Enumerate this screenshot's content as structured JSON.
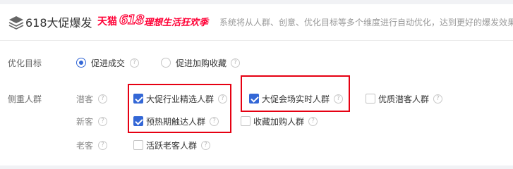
{
  "header": {
    "title": "618大促爆发",
    "logo_text_a": "天猫",
    "logo_text_num": "618",
    "logo_text_b": "理想生活狂欢季",
    "subtitle": "系统将从人群、创意、优化目标等多个维度进行自动优化，达到更好的爆发效果"
  },
  "optimization": {
    "label": "优化目标",
    "help": "?",
    "options": [
      {
        "label": "促进成交",
        "selected": true
      },
      {
        "label": "促进加购收藏",
        "selected": false
      }
    ]
  },
  "audience": {
    "label": "侧重人群",
    "help": "?",
    "groups": [
      {
        "label": "潜客",
        "options": [
          {
            "label": "大促行业精选人群",
            "checked": true
          },
          {
            "label": "大促会场实时人群",
            "checked": true
          },
          {
            "label": "优质潜客人群",
            "checked": false
          }
        ]
      },
      {
        "label": "新客",
        "options": [
          {
            "label": "预热期触达人群",
            "checked": true
          },
          {
            "label": "收藏加购人群",
            "checked": false
          }
        ]
      },
      {
        "label": "老客",
        "options": [
          {
            "label": "活跃老客人群",
            "checked": false
          }
        ]
      }
    ]
  },
  "colors": {
    "accent": "#3367d6",
    "highlight": "#e60012",
    "brand": "#ff0036"
  }
}
